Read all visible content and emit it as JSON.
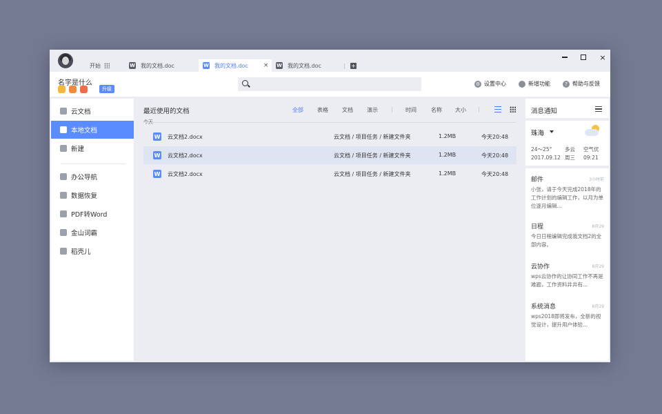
{
  "titlebar": {
    "start_label": "开始",
    "tabs": [
      {
        "label": "我的文档.doc",
        "icon": "word-icon",
        "active": false
      },
      {
        "label": "我的文档.doc",
        "icon": "word-icon",
        "active": true,
        "close": "×"
      },
      {
        "label": "我的文档.doc",
        "icon": "word-icon",
        "active": false
      }
    ],
    "add_tab": "+",
    "controls": {
      "close": "×"
    }
  },
  "toolbar": {
    "username": "名字是什么",
    "upgrade_label": "升级",
    "badge_colors": [
      "#f5b83d",
      "#f08a3c",
      "#ef6d4a"
    ],
    "settings_label": "设置中心",
    "new_features_label": "新增功能",
    "help_label": "帮助与反馈"
  },
  "sidebar": {
    "items": [
      {
        "label": "云文档",
        "icon": "cloud-icon"
      },
      {
        "label": "本地文档",
        "icon": "document-icon",
        "active": true
      },
      {
        "label": "新建",
        "icon": "plus-icon"
      },
      {
        "label": "办公导航",
        "icon": "compass-icon"
      },
      {
        "label": "数据恢复",
        "icon": "restore-icon"
      },
      {
        "label": "PDF转Word",
        "icon": "pdf-icon"
      },
      {
        "label": "金山词霸",
        "icon": "dictionary-icon"
      },
      {
        "label": "稻壳儿",
        "icon": "docer-icon"
      }
    ]
  },
  "main": {
    "title": "最近使用的文档",
    "filters": [
      "全部",
      "表格",
      "文档",
      "演示"
    ],
    "active_filter": "全部",
    "sorts": [
      "时间",
      "名称",
      "大小"
    ],
    "group_label": "今天",
    "files": [
      {
        "name": "云文档2.docx",
        "path": "云文档 / 项目任务 / 新建文件夹",
        "size": "1.2MB",
        "time": "今天20:48",
        "selected": false
      },
      {
        "name": "云文档2.docx",
        "path": "云文档 / 项目任务 / 新建文件夹",
        "size": "1.2MB",
        "time": "今天20:48",
        "selected": true
      },
      {
        "name": "云文档2.docx",
        "path": "云文档 / 项目任务 / 新建文件夹",
        "size": "1.2MB",
        "time": "今天20:48",
        "selected": false
      }
    ]
  },
  "notifications": {
    "title": "消息通知",
    "weather": {
      "city": "珠海",
      "temp": "24～25",
      "temp_unit": "°",
      "date": "2017.09.12",
      "condition": "多云",
      "weekday": "周三",
      "air": "空气优",
      "time": "09:21"
    },
    "messages": [
      {
        "title": "邮件",
        "time": "3小时前",
        "body": "小张，请于今天完成2018年的工作计划的编辑工作，以月为单位逐月编辑..."
      },
      {
        "title": "日程",
        "time": "8月29",
        "body": "今日日程编辑完成我文档2的全部内容。"
      },
      {
        "title": "云协作",
        "time": "8月29",
        "body": "wps云协作的让协同工作不再是难题，工作资料井井有..."
      },
      {
        "title": "系统消息",
        "time": "8月29",
        "body": "wps2018即将发布，全新的视觉设计，提升用户体验..."
      }
    ]
  }
}
